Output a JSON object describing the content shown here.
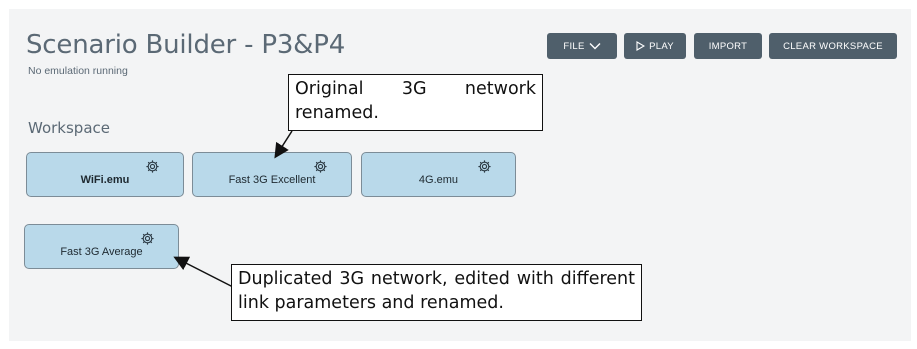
{
  "header": {
    "title": "Scenario Builder - P3&P4",
    "status": "No emulation running"
  },
  "toolbar": {
    "file_label": "FILE",
    "play_label": "PLAY",
    "import_label": "IMPORT",
    "clear_label": "CLEAR WORKSPACE"
  },
  "workspace": {
    "label": "Workspace",
    "nodes": [
      {
        "label": "WiFi.emu"
      },
      {
        "label": "Fast 3G Excellent"
      },
      {
        "label": "4G.emu"
      },
      {
        "label": "Fast 3G Average"
      }
    ]
  },
  "annotations": {
    "top": "Original 3G network renamed.",
    "bottom": "Duplicated 3G network, edited with different link parameters and renamed."
  },
  "colors": {
    "panel_bg": "#f3f4f5",
    "button_bg": "#4f5f6b",
    "node_bg": "#b9d9ea",
    "node_border": "#7c8c97",
    "title_text": "#5b6975"
  },
  "icons": {
    "file_dropdown": "chevron-down-icon",
    "play": "play-triangle-icon",
    "node_settings": "gear-icon"
  }
}
